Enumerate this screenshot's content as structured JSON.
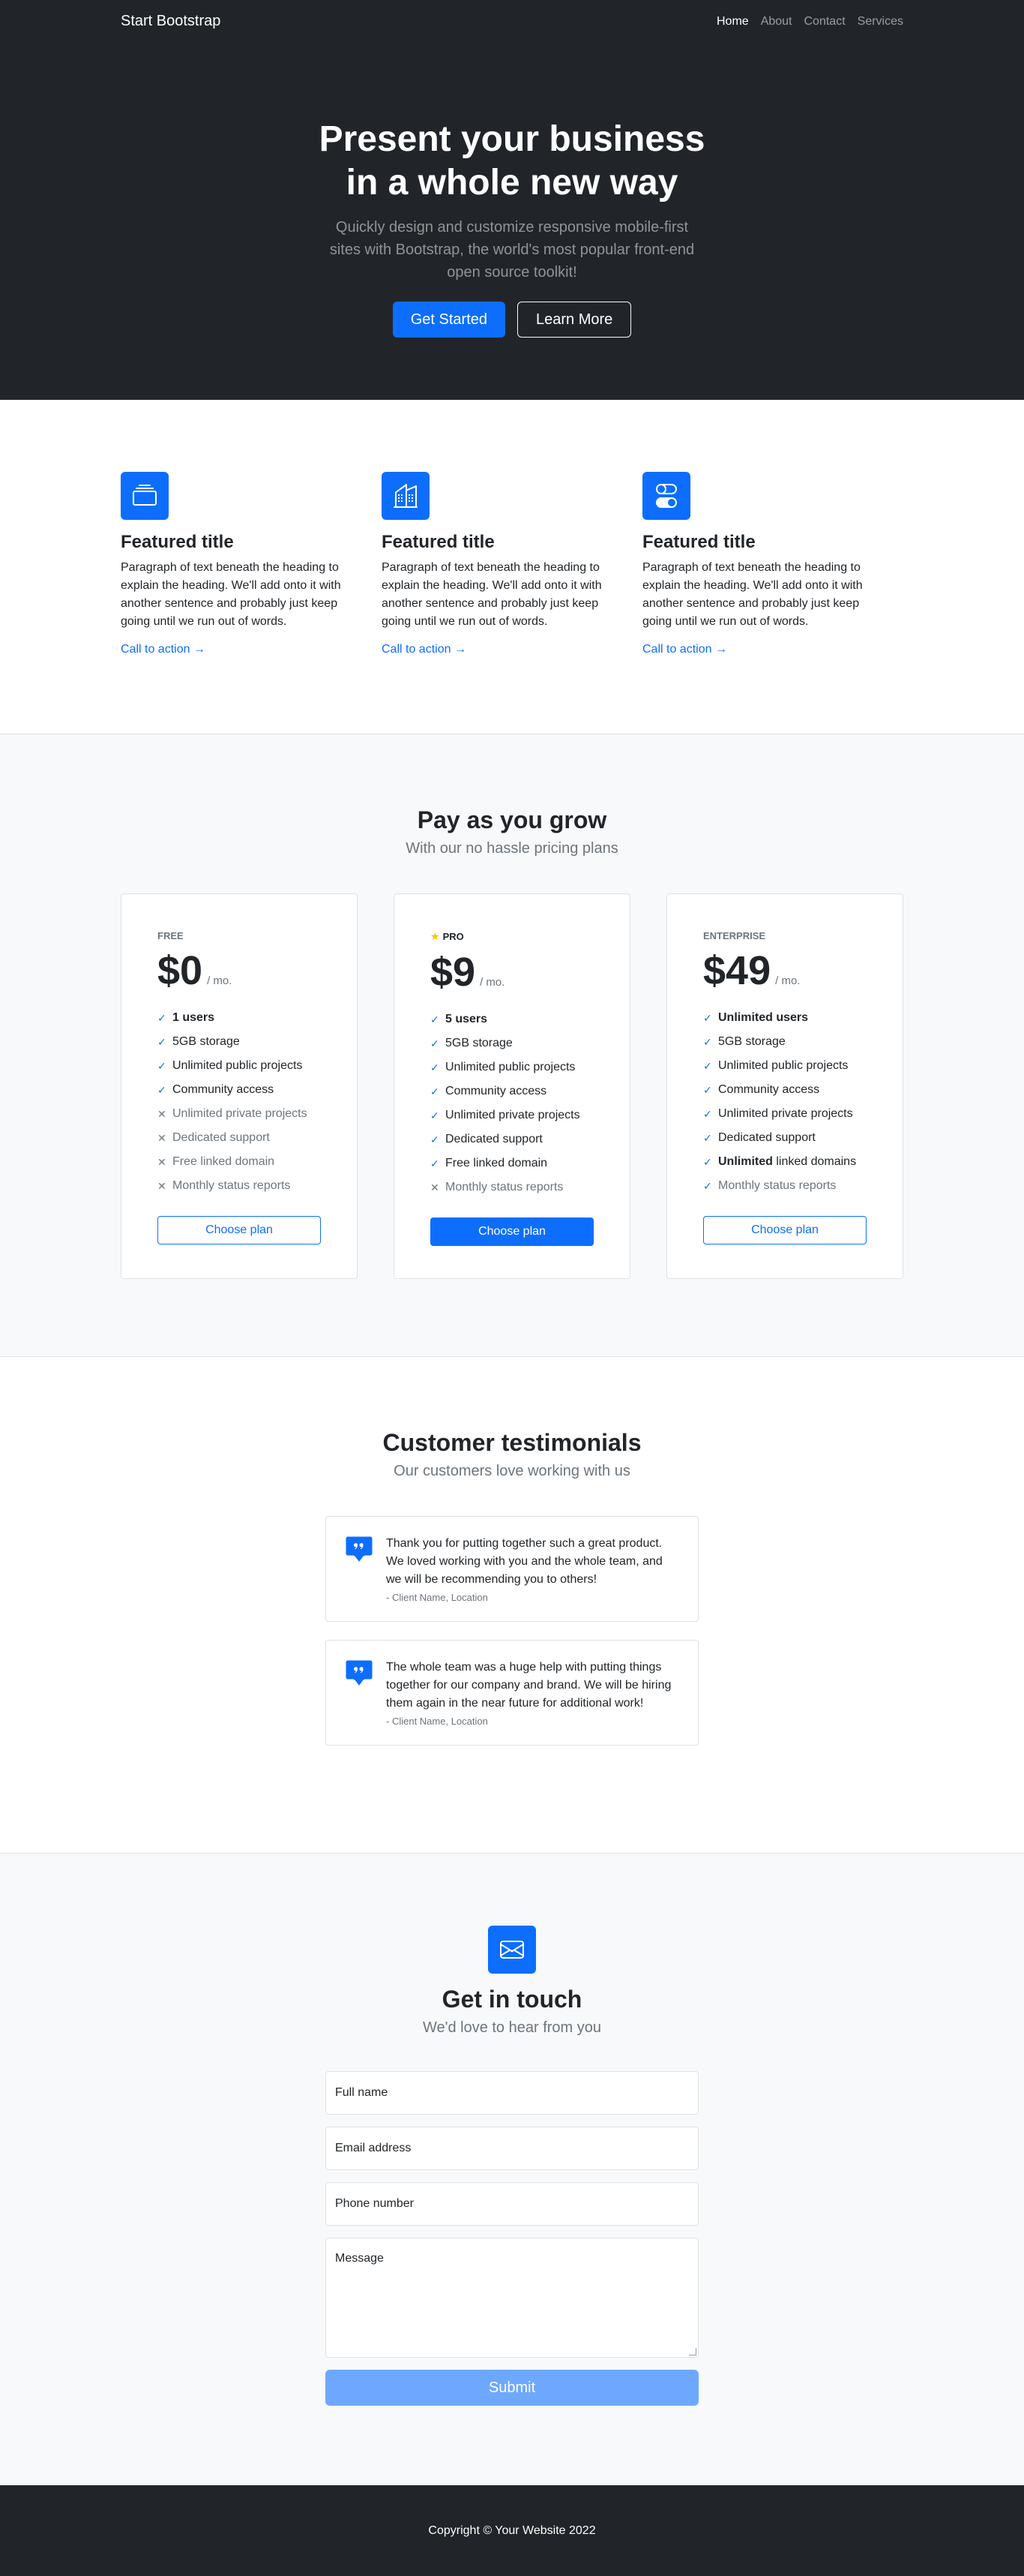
{
  "nav": {
    "brand": "Start Bootstrap",
    "links": [
      "Home",
      "About",
      "Contact",
      "Services"
    ]
  },
  "hero": {
    "title": "Present your business in a whole new way",
    "subtitle": "Quickly design and customize responsive mobile-first sites with Bootstrap, the world's most popular front-end open source toolkit!",
    "primary_btn": "Get Started",
    "secondary_btn": "Learn More"
  },
  "features": [
    {
      "icon": "collection-icon",
      "title": "Featured title",
      "text": "Paragraph of text beneath the heading to explain the heading. We'll add onto it with another sentence and probably just keep going until we run out of words.",
      "cta": "Call to action"
    },
    {
      "icon": "building-icon",
      "title": "Featured title",
      "text": "Paragraph of text beneath the heading to explain the heading. We'll add onto it with another sentence and probably just keep going until we run out of words.",
      "cta": "Call to action"
    },
    {
      "icon": "toggles-icon",
      "title": "Featured title",
      "text": "Paragraph of text beneath the heading to explain the heading. We'll add onto it with another sentence and probably just keep going until we run out of words.",
      "cta": "Call to action"
    }
  ],
  "pricing": {
    "title": "Pay as you grow",
    "subtitle": "With our no hassle pricing plans",
    "per": "/ mo.",
    "plans": [
      {
        "name": "Free",
        "price": "$0",
        "button": "Choose plan",
        "f": [
          "1 users",
          "5GB storage",
          "Unlimited public projects",
          "Community access",
          "Unlimited private projects",
          "Dedicated support",
          "Free linked domain",
          "Monthly status reports"
        ]
      },
      {
        "name": "Pro",
        "price": "$9",
        "button": "Choose plan",
        "f": [
          "5 users",
          "5GB storage",
          "Unlimited public projects",
          "Community access",
          "Unlimited private projects",
          "Dedicated support",
          "Free linked domain",
          "Monthly status reports"
        ]
      },
      {
        "name": "Enterprise",
        "price": "$49",
        "button": "Choose plan",
        "f": [
          "Unlimited users",
          "5GB storage",
          "Unlimited public projects",
          "Community access",
          "Unlimited private projects",
          "Dedicated support",
          "Unlimited",
          "linked domains",
          "Monthly status reports"
        ]
      }
    ]
  },
  "testimonials": {
    "title": "Customer testimonials",
    "subtitle": "Our customers love working with us",
    "items": [
      {
        "text": "Thank you for putting together such a great product. We loved working with you and the whole team, and we will be recommending you to others!",
        "who": "- Client Name, Location"
      },
      {
        "text": "The whole team was a huge help with putting things together for our company and brand. We will be hiring them again in the near future for additional work!",
        "who": "- Client Name, Location"
      }
    ]
  },
  "contact": {
    "title": "Get in touch",
    "subtitle": "We'd love to hear from you",
    "fields": [
      "Full name",
      "Email address",
      "Phone number",
      "Message"
    ],
    "submit": "Submit"
  },
  "footer": {
    "copyright": "Copyright © Your Website 2022"
  },
  "colors": {
    "primary": "#0d6efd",
    "dark": "#212529",
    "light": "#f8f9fa"
  }
}
